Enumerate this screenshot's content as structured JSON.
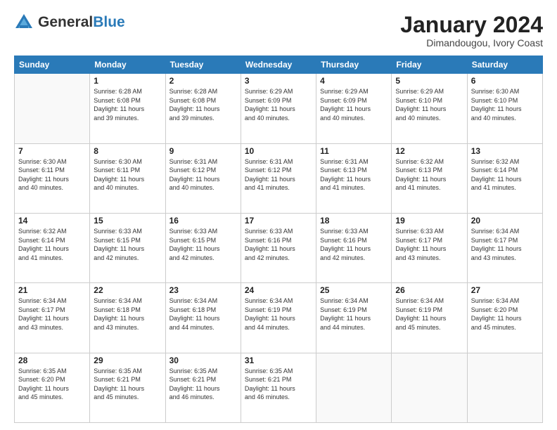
{
  "header": {
    "logo_general": "General",
    "logo_blue": "Blue",
    "month_title": "January 2024",
    "subtitle": "Dimandougou, Ivory Coast"
  },
  "weekdays": [
    "Sunday",
    "Monday",
    "Tuesday",
    "Wednesday",
    "Thursday",
    "Friday",
    "Saturday"
  ],
  "weeks": [
    [
      {
        "num": "",
        "info": ""
      },
      {
        "num": "1",
        "info": "Sunrise: 6:28 AM\nSunset: 6:08 PM\nDaylight: 11 hours\nand 39 minutes."
      },
      {
        "num": "2",
        "info": "Sunrise: 6:28 AM\nSunset: 6:08 PM\nDaylight: 11 hours\nand 39 minutes."
      },
      {
        "num": "3",
        "info": "Sunrise: 6:29 AM\nSunset: 6:09 PM\nDaylight: 11 hours\nand 40 minutes."
      },
      {
        "num": "4",
        "info": "Sunrise: 6:29 AM\nSunset: 6:09 PM\nDaylight: 11 hours\nand 40 minutes."
      },
      {
        "num": "5",
        "info": "Sunrise: 6:29 AM\nSunset: 6:10 PM\nDaylight: 11 hours\nand 40 minutes."
      },
      {
        "num": "6",
        "info": "Sunrise: 6:30 AM\nSunset: 6:10 PM\nDaylight: 11 hours\nand 40 minutes."
      }
    ],
    [
      {
        "num": "7",
        "info": "Sunrise: 6:30 AM\nSunset: 6:11 PM\nDaylight: 11 hours\nand 40 minutes."
      },
      {
        "num": "8",
        "info": "Sunrise: 6:30 AM\nSunset: 6:11 PM\nDaylight: 11 hours\nand 40 minutes."
      },
      {
        "num": "9",
        "info": "Sunrise: 6:31 AM\nSunset: 6:12 PM\nDaylight: 11 hours\nand 40 minutes."
      },
      {
        "num": "10",
        "info": "Sunrise: 6:31 AM\nSunset: 6:12 PM\nDaylight: 11 hours\nand 41 minutes."
      },
      {
        "num": "11",
        "info": "Sunrise: 6:31 AM\nSunset: 6:13 PM\nDaylight: 11 hours\nand 41 minutes."
      },
      {
        "num": "12",
        "info": "Sunrise: 6:32 AM\nSunset: 6:13 PM\nDaylight: 11 hours\nand 41 minutes."
      },
      {
        "num": "13",
        "info": "Sunrise: 6:32 AM\nSunset: 6:14 PM\nDaylight: 11 hours\nand 41 minutes."
      }
    ],
    [
      {
        "num": "14",
        "info": "Sunrise: 6:32 AM\nSunset: 6:14 PM\nDaylight: 11 hours\nand 41 minutes."
      },
      {
        "num": "15",
        "info": "Sunrise: 6:33 AM\nSunset: 6:15 PM\nDaylight: 11 hours\nand 42 minutes."
      },
      {
        "num": "16",
        "info": "Sunrise: 6:33 AM\nSunset: 6:15 PM\nDaylight: 11 hours\nand 42 minutes."
      },
      {
        "num": "17",
        "info": "Sunrise: 6:33 AM\nSunset: 6:16 PM\nDaylight: 11 hours\nand 42 minutes."
      },
      {
        "num": "18",
        "info": "Sunrise: 6:33 AM\nSunset: 6:16 PM\nDaylight: 11 hours\nand 42 minutes."
      },
      {
        "num": "19",
        "info": "Sunrise: 6:33 AM\nSunset: 6:17 PM\nDaylight: 11 hours\nand 43 minutes."
      },
      {
        "num": "20",
        "info": "Sunrise: 6:34 AM\nSunset: 6:17 PM\nDaylight: 11 hours\nand 43 minutes."
      }
    ],
    [
      {
        "num": "21",
        "info": "Sunrise: 6:34 AM\nSunset: 6:17 PM\nDaylight: 11 hours\nand 43 minutes."
      },
      {
        "num": "22",
        "info": "Sunrise: 6:34 AM\nSunset: 6:18 PM\nDaylight: 11 hours\nand 43 minutes."
      },
      {
        "num": "23",
        "info": "Sunrise: 6:34 AM\nSunset: 6:18 PM\nDaylight: 11 hours\nand 44 minutes."
      },
      {
        "num": "24",
        "info": "Sunrise: 6:34 AM\nSunset: 6:19 PM\nDaylight: 11 hours\nand 44 minutes."
      },
      {
        "num": "25",
        "info": "Sunrise: 6:34 AM\nSunset: 6:19 PM\nDaylight: 11 hours\nand 44 minutes."
      },
      {
        "num": "26",
        "info": "Sunrise: 6:34 AM\nSunset: 6:19 PM\nDaylight: 11 hours\nand 45 minutes."
      },
      {
        "num": "27",
        "info": "Sunrise: 6:34 AM\nSunset: 6:20 PM\nDaylight: 11 hours\nand 45 minutes."
      }
    ],
    [
      {
        "num": "28",
        "info": "Sunrise: 6:35 AM\nSunset: 6:20 PM\nDaylight: 11 hours\nand 45 minutes."
      },
      {
        "num": "29",
        "info": "Sunrise: 6:35 AM\nSunset: 6:21 PM\nDaylight: 11 hours\nand 45 minutes."
      },
      {
        "num": "30",
        "info": "Sunrise: 6:35 AM\nSunset: 6:21 PM\nDaylight: 11 hours\nand 46 minutes."
      },
      {
        "num": "31",
        "info": "Sunrise: 6:35 AM\nSunset: 6:21 PM\nDaylight: 11 hours\nand 46 minutes."
      },
      {
        "num": "",
        "info": ""
      },
      {
        "num": "",
        "info": ""
      },
      {
        "num": "",
        "info": ""
      }
    ]
  ]
}
